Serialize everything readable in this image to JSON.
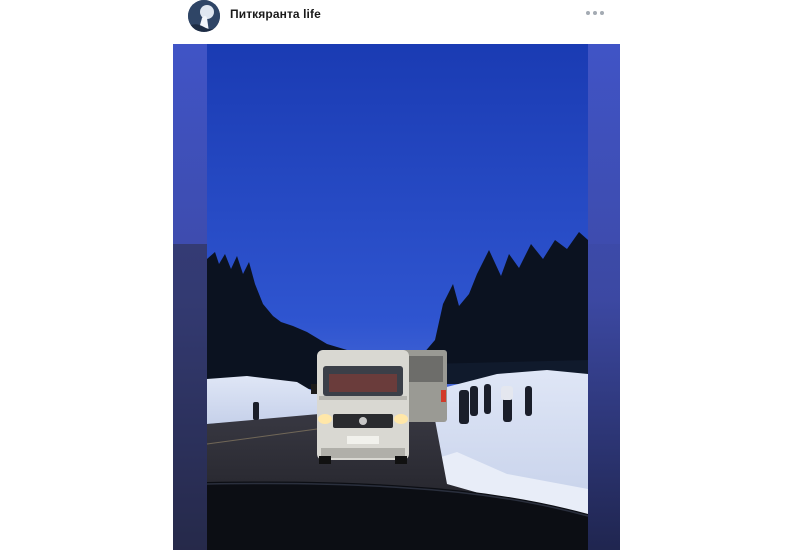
{
  "post": {
    "channel_name": "Питкяранта life",
    "avatar_icon": "channel-avatar",
    "more_icon": "more-horizontal-icon"
  },
  "photo": {
    "icon": "photo-winter-road-minibus",
    "colors": {
      "sky_top": "#1b3fb0",
      "sky_bottom": "#5a73d8",
      "snow": "#e6ecf7",
      "trees": "#0d1420",
      "blur_side": "#4d5fb8"
    }
  }
}
